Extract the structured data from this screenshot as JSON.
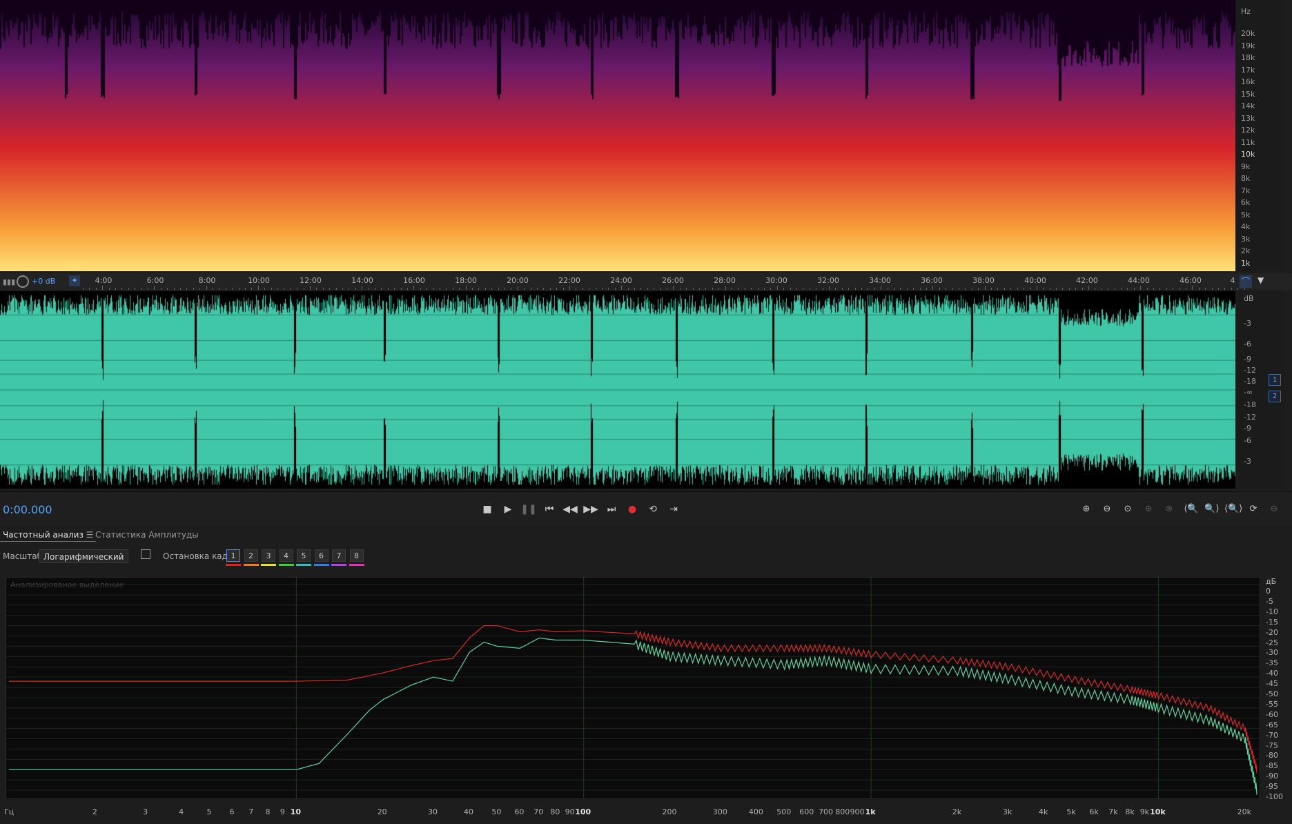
{
  "freq_axis": {
    "unit": "Hz",
    "labels": [
      "20k",
      "19k",
      "18k",
      "17k",
      "16k",
      "15k",
      "14k",
      "13k",
      "12k",
      "11k",
      "10k",
      "9k",
      "8k",
      "7k",
      "6k",
      "5k",
      "4k",
      "3k",
      "2k",
      "1k"
    ]
  },
  "timeline": {
    "level": "+0 dB",
    "marks": [
      "4:00",
      "6:00",
      "8:00",
      "10:00",
      "12:00",
      "14:00",
      "16:00",
      "18:00",
      "20:00",
      "22:00",
      "24:00",
      "26:00",
      "28:00",
      "30:00",
      "32:00",
      "34:00",
      "36:00",
      "38:00",
      "40:00",
      "42:00",
      "44:00",
      "46:00",
      "4"
    ]
  },
  "waveform": {
    "unit": "dB",
    "labels": [
      "-3",
      "-6",
      "-9",
      "-12",
      "-18",
      "-∞",
      "-18",
      "-12",
      "-9",
      "-6",
      "-3"
    ],
    "channels": [
      "1",
      "2"
    ],
    "color": "#3fc7a8"
  },
  "transport": {
    "time": "0:00.000",
    "buttons": [
      "stop",
      "play",
      "pause",
      "to-start",
      "rewind",
      "fast-forward",
      "to-end",
      "record",
      "loop",
      "skip"
    ]
  },
  "tabs": {
    "freq": "Частотный анализ",
    "amp": "Статистика Амплитуды"
  },
  "controls": {
    "scale_label": "Масштаб:",
    "scale_value": "Логарифмический",
    "freeze_label": "Остановка кадра:",
    "frames": [
      "1",
      "2",
      "3",
      "4",
      "5",
      "6",
      "7",
      "8"
    ],
    "frame_colors": [
      "#e0201c",
      "#f07d1a",
      "#e8e020",
      "#3ad03a",
      "#30c0c0",
      "#2f7de0",
      "#b040e0",
      "#e030c0"
    ]
  },
  "analysis": {
    "caption": "Анализированое выделение",
    "db_unit": "дБ",
    "db_labels": [
      "0",
      "-5",
      "-10",
      "-15",
      "-20",
      "-25",
      "-30",
      "-35",
      "-40",
      "-45",
      "-50",
      "-55",
      "-60",
      "-65",
      "-70",
      "-75",
      "-80",
      "-85",
      "-90",
      "-95",
      "-100"
    ],
    "hz_unit": "Гц",
    "hz_labels": [
      "2",
      "3",
      "4",
      "5",
      "6",
      "7",
      "8",
      "9",
      "10",
      "20",
      "30",
      "40",
      "50",
      "60",
      "70",
      "80",
      "90",
      "100",
      "200",
      "300",
      "400",
      "500",
      "600",
      "700",
      "800",
      "900",
      "1k",
      "2k",
      "3k",
      "4k",
      "5k",
      "6k",
      "7k",
      "8k",
      "9k",
      "10k",
      "20k"
    ]
  },
  "chart_data": {
    "type": "line",
    "x_scale": "log",
    "xlim": [
      1,
      22000
    ],
    "ylim": [
      -100,
      0
    ],
    "series": [
      {
        "color": "#d42a2a",
        "x": [
          1,
          10,
          15,
          20,
          25,
          30,
          35,
          40,
          45,
          50,
          60,
          70,
          80,
          100,
          150,
          200,
          300,
          500,
          700,
          1000,
          2000,
          3000,
          5000,
          8000,
          10000,
          15000,
          20000,
          22000
        ],
        "y": [
          -47,
          -47,
          -46.5,
          -43,
          -39.5,
          -37,
          -36,
          -26,
          -20,
          -20,
          -23,
          -22,
          -23,
          -22.5,
          -24,
          -28,
          -31,
          -31,
          -31,
          -34,
          -37,
          -40,
          -46,
          -51,
          -54,
          -60,
          -70,
          -90
        ]
      },
      {
        "color": "#5fd0a0",
        "x": [
          1,
          10,
          12,
          15,
          18,
          20,
          25,
          30,
          35,
          40,
          45,
          50,
          60,
          70,
          80,
          100,
          150,
          200,
          300,
          500,
          700,
          1000,
          2000,
          3000,
          5000,
          8000,
          10000,
          15000,
          20000,
          22000
        ],
        "y": [
          -90,
          -90,
          -87,
          -73,
          -61,
          -56,
          -49,
          -45,
          -47,
          -33,
          -28,
          -30,
          -31,
          -26,
          -27,
          -27,
          -29,
          -35,
          -37,
          -39,
          -37,
          -41,
          -42,
          -46,
          -52,
          -56,
          -60,
          -66,
          -75,
          -100
        ]
      }
    ]
  }
}
